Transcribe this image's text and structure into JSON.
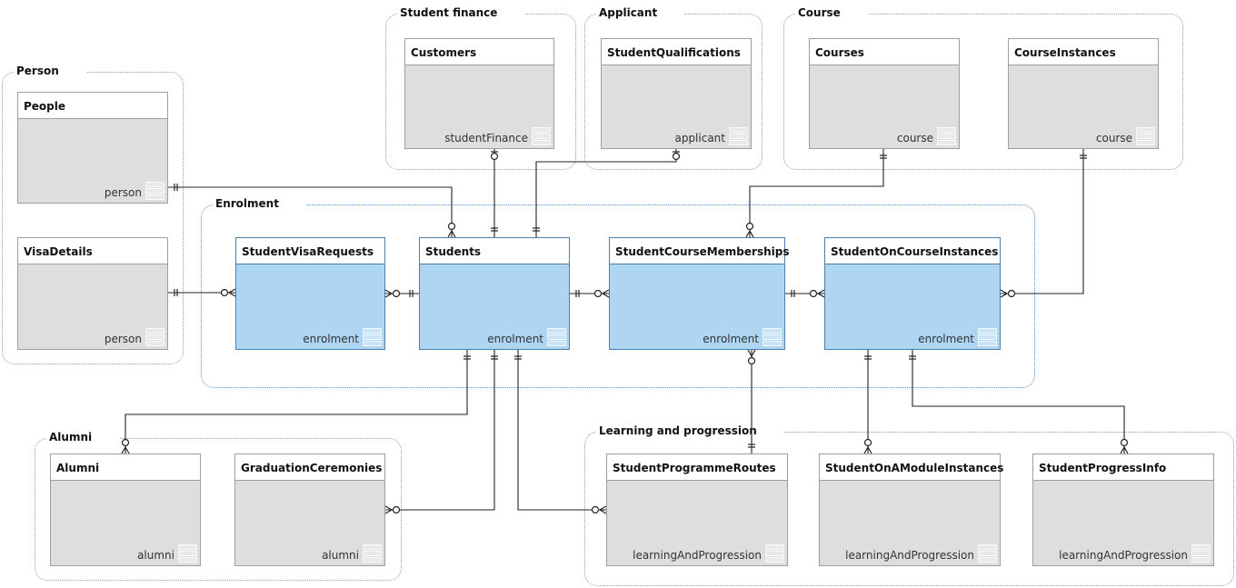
{
  "groups": [
    {
      "id": "person",
      "label": "Person"
    },
    {
      "id": "finance",
      "label": "Student finance"
    },
    {
      "id": "applicant",
      "label": "Applicant"
    },
    {
      "id": "course",
      "label": "Course"
    },
    {
      "id": "enrolment",
      "label": "Enrolment"
    },
    {
      "id": "alumni",
      "label": "Alumni"
    },
    {
      "id": "learning",
      "label": "Learning and progression"
    }
  ],
  "entities": [
    {
      "id": "People",
      "name": "People",
      "schema": "person"
    },
    {
      "id": "VisaDetails",
      "name": "VisaDetails",
      "schema": "person"
    },
    {
      "id": "Customers",
      "name": "Customers",
      "schema": "studentFinance"
    },
    {
      "id": "StudentQualifications",
      "name": "StudentQualifications",
      "schema": "applicant"
    },
    {
      "id": "Courses",
      "name": "Courses",
      "schema": "course"
    },
    {
      "id": "CourseInstances",
      "name": "CourseInstances",
      "schema": "course"
    },
    {
      "id": "StudentVisaRequests",
      "name": "StudentVisaRequests",
      "schema": "enrolment"
    },
    {
      "id": "Students",
      "name": "Students",
      "schema": "enrolment"
    },
    {
      "id": "StudentCourseMemberships",
      "name": "StudentCourseMemberships",
      "schema": "enrolment"
    },
    {
      "id": "StudentOnCourseInstances",
      "name": "StudentOnCourseInstances",
      "schema": "enrolment"
    },
    {
      "id": "Alumni",
      "name": "Alumni",
      "schema": "alumni"
    },
    {
      "id": "GraduationCeremonies",
      "name": "GraduationCeremonies",
      "schema": "alumni"
    },
    {
      "id": "StudentProgrammeRoutes",
      "name": "StudentProgrammeRoutes",
      "schema": "learningAndProgression"
    },
    {
      "id": "StudentOnAModuleInstances",
      "name": "StudentOnAModuleInstances",
      "schema": "learningAndProgression"
    },
    {
      "id": "StudentProgressInfo",
      "name": "StudentProgressInfo",
      "schema": "learningAndProgression"
    }
  ],
  "colors": {
    "enrolment_fill": "#aed6f2",
    "other_fill": "#dedede",
    "line": "#222222"
  },
  "relationships": [
    {
      "from": "People",
      "to": "Students",
      "from_card": "one",
      "to_card": "zero-or-many"
    },
    {
      "from": "VisaDetails",
      "to": "StudentVisaRequests",
      "from_card": "one",
      "to_card": "zero-or-many"
    },
    {
      "from": "StudentVisaRequests",
      "to": "Students",
      "from_card": "zero-or-many",
      "to_card": "one"
    },
    {
      "from": "Customers",
      "to": "Students",
      "from_card": "zero-or-one",
      "to_card": "one"
    },
    {
      "from": "StudentQualifications",
      "to": "Students",
      "from_card": "zero-or-one",
      "to_card": "one"
    },
    {
      "from": "Courses",
      "to": "StudentCourseMemberships",
      "from_card": "one",
      "to_card": "zero-or-many"
    },
    {
      "from": "CourseInstances",
      "to": "StudentOnCourseInstances",
      "from_card": "one",
      "to_card": "zero-or-many"
    },
    {
      "from": "Students",
      "to": "StudentCourseMemberships",
      "from_card": "one",
      "to_card": "zero-or-many"
    },
    {
      "from": "StudentCourseMemberships",
      "to": "StudentOnCourseInstances",
      "from_card": "one",
      "to_card": "zero-or-many"
    },
    {
      "from": "Students",
      "to": "Alumni",
      "from_card": "one",
      "to_card": "zero-or-many"
    },
    {
      "from": "Students",
      "to": "GraduationCeremonies",
      "from_card": "one",
      "to_card": "zero-or-many"
    },
    {
      "from": "Students",
      "to": "StudentProgrammeRoutes",
      "from_card": "one",
      "to_card": "zero-or-many"
    },
    {
      "from": "StudentCourseMemberships",
      "to": "StudentProgrammeRoutes",
      "from_card": "zero-or-many",
      "to_card": "one"
    },
    {
      "from": "StudentOnCourseInstances",
      "to": "StudentOnAModuleInstances",
      "from_card": "one",
      "to_card": "zero-or-many"
    },
    {
      "from": "StudentOnCourseInstances",
      "to": "StudentProgressInfo",
      "from_card": "one",
      "to_card": "zero-or-many"
    }
  ]
}
